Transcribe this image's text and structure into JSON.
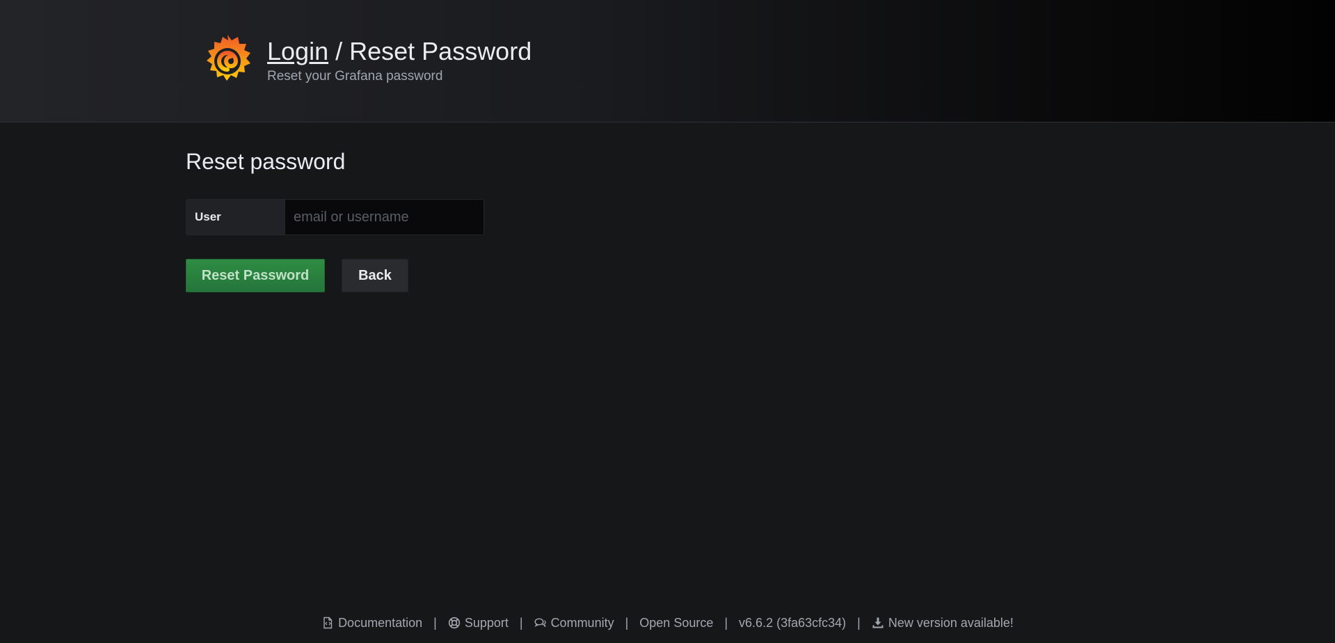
{
  "header": {
    "breadcrumb_link": "Login",
    "breadcrumb_separator": " / ",
    "breadcrumb_current": "Reset Password",
    "subtitle": "Reset your Grafana password",
    "logo_icon": "grafana-logo-icon"
  },
  "main": {
    "heading": "Reset password",
    "user_label": "User",
    "user_input_value": "",
    "user_input_placeholder": "email or username",
    "reset_button_label": "Reset Password",
    "back_button_label": "Back"
  },
  "footer": {
    "documentation": "Documentation",
    "documentation_icon": "document-icon",
    "support": "Support",
    "support_icon": "lifebuoy-icon",
    "community": "Community",
    "community_icon": "comments-icon",
    "open_source": "Open Source",
    "version": "v6.6.2 (3fa63cfc34)",
    "new_version": "New version available!",
    "new_version_icon": "download-icon",
    "separator": "|"
  },
  "colors": {
    "background": "#161719",
    "success": "#299c46",
    "logo_orange": "#f05a28",
    "logo_yellow": "#fbca0a"
  }
}
